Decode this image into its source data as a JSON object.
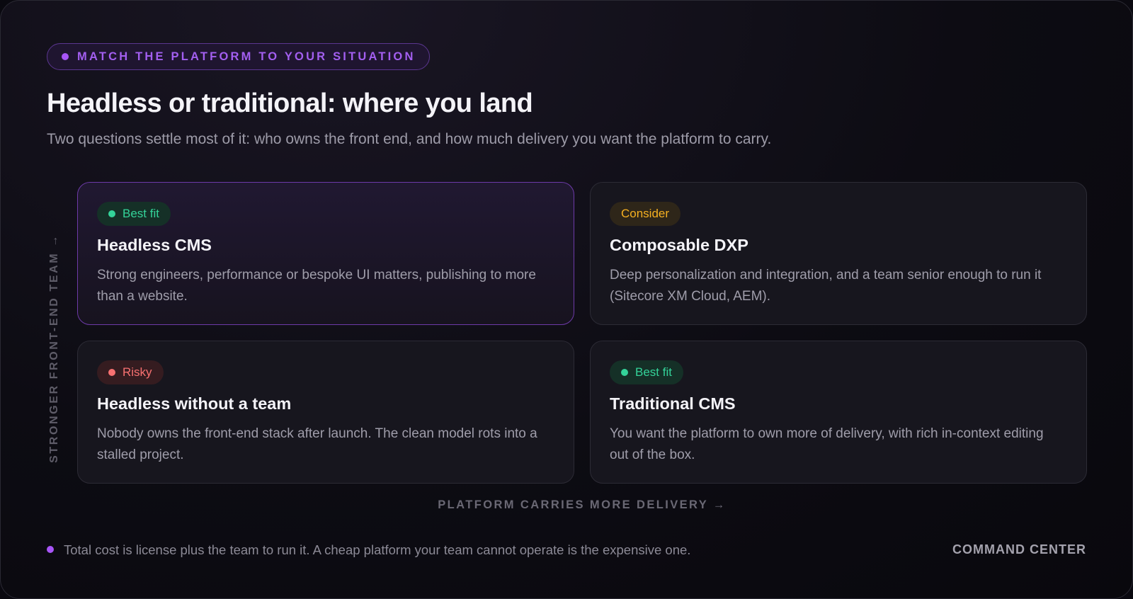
{
  "eyebrow": "MATCH THE PLATFORM TO YOUR SITUATION",
  "title": "Headless or traditional: where you land",
  "subtitle": "Two questions settle most of it: who owns the front end, and how much delivery you want the platform to carry.",
  "axes": {
    "y_label": "STRONGER FRONT-END TEAM →",
    "x_label": "PLATFORM CARRIES MORE DELIVERY →"
  },
  "quadrants": {
    "top_left": {
      "badge": "Best fit",
      "badge_tone": "good",
      "title": "Headless CMS",
      "description": "Strong engineers, performance or bespoke UI matters, publishing to more than a website."
    },
    "top_right": {
      "badge": "Consider",
      "badge_tone": "consider",
      "title": "Composable DXP",
      "description": "Deep personalization and integration, and a team senior enough to run it (Sitecore XM Cloud, AEM)."
    },
    "bottom_left": {
      "badge": "Risky",
      "badge_tone": "risky",
      "title": "Headless without a team",
      "description": "Nobody owns the front-end stack after launch. The clean model rots into a stalled project."
    },
    "bottom_right": {
      "badge": "Best fit",
      "badge_tone": "good",
      "title": "Traditional CMS",
      "description": "You want the platform to own more of delivery, with rich in-context editing out of the box."
    }
  },
  "footnote": "Total cost is license plus the team to run it. A cheap platform your team cannot operate is the expensive one.",
  "brand": "COMMAND CENTER",
  "colors": {
    "accent": "#a855f7",
    "good": "#34d399",
    "consider": "#f5b021",
    "risky": "#f87171"
  }
}
